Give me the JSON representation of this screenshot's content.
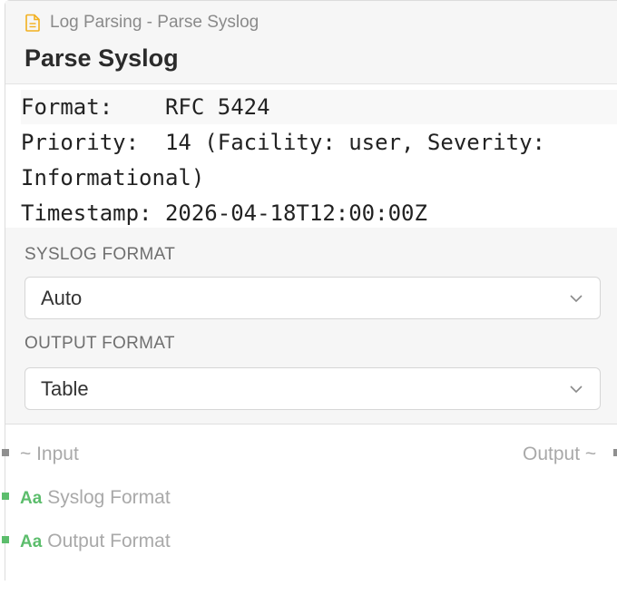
{
  "header": {
    "breadcrumb": "Log Parsing - Parse Syslog",
    "title": "Parse Syslog"
  },
  "output": {
    "lines": [
      "Format:    RFC 5424",
      "Priority:  14 (Facility: user, Severity:",
      "Informational)",
      "Timestamp: 2026-04-18T12:00:00Z"
    ]
  },
  "fields": {
    "syslog_format": {
      "label": "SYSLOG FORMAT",
      "value": "Auto"
    },
    "output_format": {
      "label": "OUTPUT FORMAT",
      "value": "Table"
    }
  },
  "ports": {
    "input_label": "~ Input",
    "output_label": "Output ~",
    "type_badge": "Aa",
    "syslog_format_label": "Syslog Format",
    "output_format_label": "Output Format"
  },
  "colors": {
    "accent_yellow": "#f2b01e",
    "port_green": "#5cbd6c",
    "port_gray": "#8f8f8f"
  },
  "icons": {
    "breadcrumb": "document-icon",
    "dropdown": "chevron-down-icon"
  }
}
